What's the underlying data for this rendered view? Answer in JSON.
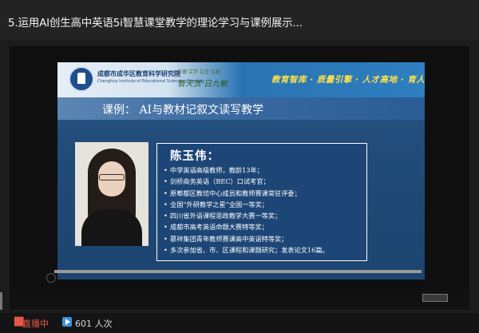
{
  "title": "5.运用AI创生高中英语5i智慧课堂教学的理论学习与课例展示...",
  "slide": {
    "header": {
      "institute_name": "成都市成华区教育科学研究院",
      "institute_en": "Chenghua Institute of Educational Sciences, Chengdu",
      "motto_small": "立德·立学·立言·立品",
      "motto_script": "智天赏·日九敏",
      "slogan": "教育智库 · 质量引擎 · 人才高地 · 育人摇篮"
    },
    "case_title": "课例：  AI与教材记叙文读写教学",
    "person_name": "陈玉伟：",
    "bio": [
      "中学英语高级教师，教龄13年；",
      "剑桥商务英语（BEC）口试考官；",
      "原郫都区教培中心成员和教师赛课常驻评委；",
      "全国“外研教学之星”全国一等奖；",
      "四川省外语课程思政教学大赛一等奖；",
      "成都市高考英语命题大赛特等奖；",
      "慕祥集团青年教师赛课高中英语特等奖；",
      "多次参加省、市、区课程和课题研究；发表论文16篇。"
    ]
  },
  "status": {
    "live_label": "直播中",
    "views_label": "601 人次"
  },
  "colors": {
    "slogan": "#ffe24a",
    "live": "#e8584a",
    "views_icon": "#3d8fe0"
  },
  "icons": {
    "live": "signal-bars-icon",
    "views": "play-square-icon"
  }
}
